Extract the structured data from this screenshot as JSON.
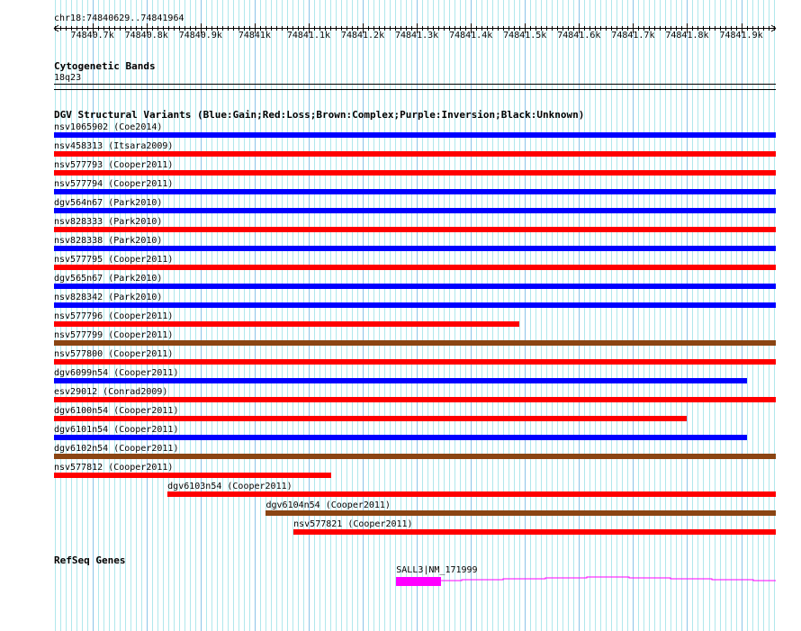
{
  "region": {
    "label": "chr18:74840629..74841964",
    "start": 74840629,
    "end": 74841964,
    "ticks": [
      {
        "pos": 74840700,
        "label": "74840.7k"
      },
      {
        "pos": 74840800,
        "label": "74840.8k"
      },
      {
        "pos": 74840900,
        "label": "74840.9k"
      },
      {
        "pos": 74841000,
        "label": "74841k"
      },
      {
        "pos": 74841100,
        "label": "74841.1k"
      },
      {
        "pos": 74841200,
        "label": "74841.2k"
      },
      {
        "pos": 74841300,
        "label": "74841.3k"
      },
      {
        "pos": 74841400,
        "label": "74841.4k"
      },
      {
        "pos": 74841500,
        "label": "74841.5k"
      },
      {
        "pos": 74841600,
        "label": "74841.6k"
      },
      {
        "pos": 74841700,
        "label": "74841.7k"
      },
      {
        "pos": 74841800,
        "label": "74841.8k"
      },
      {
        "pos": 74841900,
        "label": "74841.9k"
      }
    ]
  },
  "colors": {
    "gain": "#0000ff",
    "loss": "#ff0000",
    "complex": "#8b4513",
    "gene": "#ff00ff"
  },
  "cyto": {
    "title": "Cytogenetic Bands",
    "band": "18q23"
  },
  "dgv": {
    "title": "DGV Structural Variants (Blue:Gain;Red:Loss;Brown:Complex;Purple:Inversion;Black:Unknown)",
    "variants": [
      {
        "label": "nsv1065902 (Coe2014)",
        "type": "gain",
        "start": 74840629,
        "end": 74841964
      },
      {
        "label": "nsv458313 (Itsara2009)",
        "type": "loss",
        "start": 74840629,
        "end": 74841964
      },
      {
        "label": "nsv577793 (Cooper2011)",
        "type": "loss",
        "start": 74840629,
        "end": 74841964
      },
      {
        "label": "nsv577794 (Cooper2011)",
        "type": "gain",
        "start": 74840629,
        "end": 74841964
      },
      {
        "label": "dgv564n67 (Park2010)",
        "type": "gain",
        "start": 74840629,
        "end": 74841964
      },
      {
        "label": "nsv828333 (Park2010)",
        "type": "loss",
        "start": 74840629,
        "end": 74841964
      },
      {
        "label": "nsv828338 (Park2010)",
        "type": "gain",
        "start": 74840629,
        "end": 74841964
      },
      {
        "label": "nsv577795 (Cooper2011)",
        "type": "loss",
        "start": 74840629,
        "end": 74841964
      },
      {
        "label": "dgv565n67 (Park2010)",
        "type": "gain",
        "start": 74840629,
        "end": 74841964
      },
      {
        "label": "nsv828342 (Park2010)",
        "type": "gain",
        "start": 74840629,
        "end": 74841964
      },
      {
        "label": "nsv577796 (Cooper2011)",
        "type": "loss",
        "start": 74840629,
        "end": 74841489
      },
      {
        "label": "nsv577799 (Cooper2011)",
        "type": "complex",
        "start": 74840629,
        "end": 74841964
      },
      {
        "label": "nsv577800 (Cooper2011)",
        "type": "loss",
        "start": 74840629,
        "end": 74841964
      },
      {
        "label": "dgv6099n54 (Cooper2011)",
        "type": "gain",
        "start": 74840629,
        "end": 74841911
      },
      {
        "label": "esv29012 (Conrad2009)",
        "type": "loss",
        "start": 74840629,
        "end": 74841964
      },
      {
        "label": "dgv6100n54 (Cooper2011)",
        "type": "loss",
        "start": 74840629,
        "end": 74841799
      },
      {
        "label": "dgv6101n54 (Cooper2011)",
        "type": "gain",
        "start": 74840629,
        "end": 74841911
      },
      {
        "label": "dgv6102n54 (Cooper2011)",
        "type": "complex",
        "start": 74840629,
        "end": 74841964
      },
      {
        "label": "nsv577812 (Cooper2011)",
        "type": "loss",
        "start": 74840629,
        "end": 74841142
      },
      {
        "label": "dgv6103n54 (Cooper2011)",
        "type": "loss",
        "start": 74840839,
        "end": 74841964
      },
      {
        "label": "dgv6104n54 (Cooper2011)",
        "type": "complex",
        "start": 74841021,
        "end": 74841964
      },
      {
        "label": "nsv577821 (Cooper2011)",
        "type": "loss",
        "start": 74841072,
        "end": 74841964
      }
    ]
  },
  "refseq": {
    "title": "RefSeq Genes",
    "gene": {
      "label": "SALL3|NM_171999",
      "start": 74841262,
      "exon_end": 74841345
    }
  }
}
